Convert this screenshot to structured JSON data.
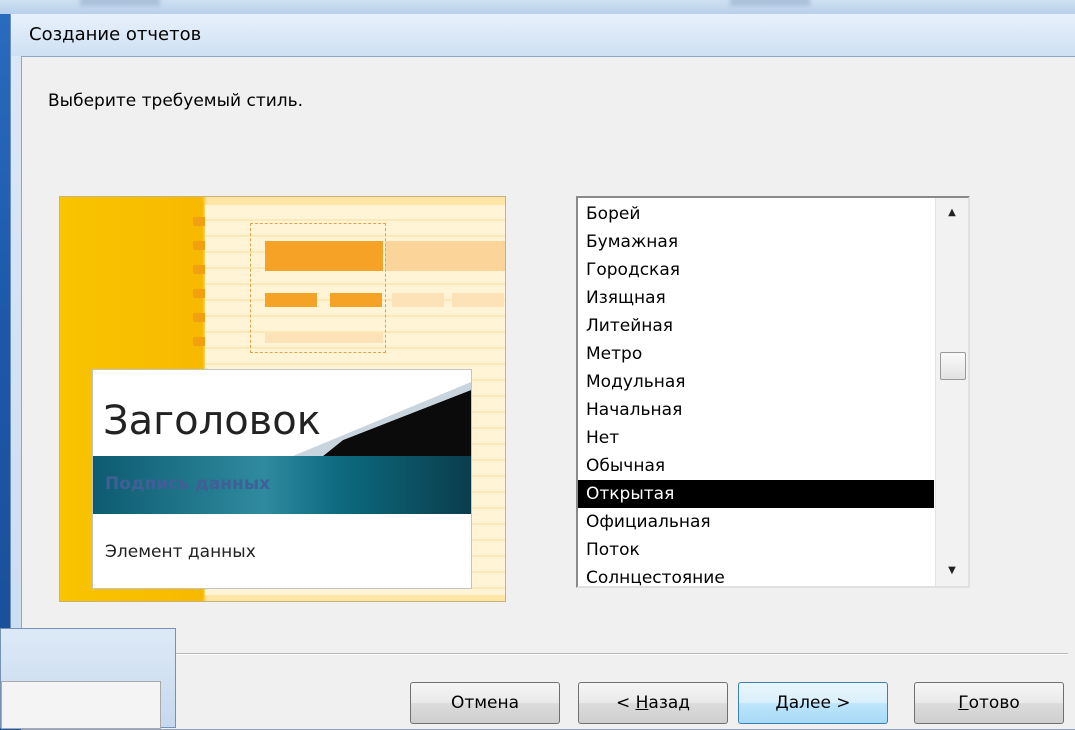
{
  "window": {
    "title": "Создание отчетов",
    "prompt": "Выберите требуемый стиль."
  },
  "preview": {
    "title_text": "Заголовок",
    "label_text": "Подпись данных",
    "item_text": "Элемент данных"
  },
  "style_list": {
    "items": [
      "Борей",
      "Бумажная",
      "Городская",
      "Изящная",
      "Литейная",
      "Метро",
      "Модульная",
      "Начальная",
      "Нет",
      "Обычная",
      "Открытая",
      "Официальная",
      "Поток",
      "Солнцестояние"
    ],
    "selected": "Открытая",
    "scroll_up_icon": "▲",
    "scroll_down_icon": "▼"
  },
  "buttons": {
    "cancel": "Отмена",
    "back_prefix": "< ",
    "back_accel": "Н",
    "back_rest": "азад",
    "next_accel": "Д",
    "next_rest": "алее >",
    "finish_accel": "Г",
    "finish_rest": "отово"
  },
  "colors": {
    "selection_bg": "#000000",
    "preview_accent": "#f5a227",
    "band_teal": "#0d5b70"
  }
}
